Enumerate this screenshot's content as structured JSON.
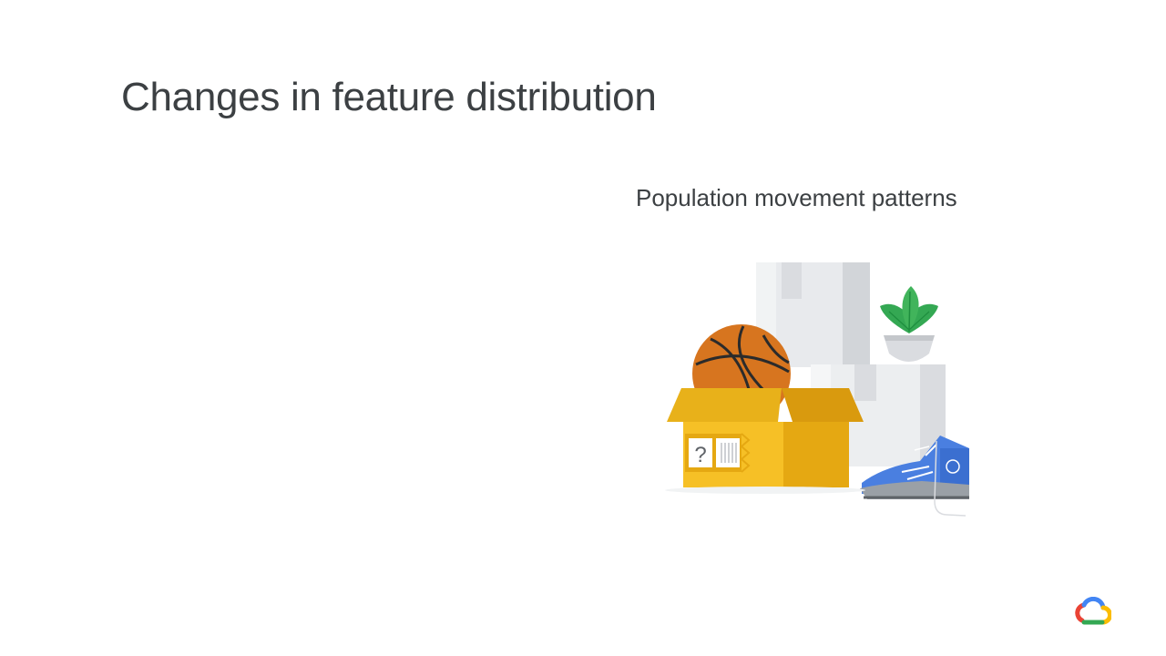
{
  "slide": {
    "title": "Changes in feature distribution",
    "subtitle": "Population movement patterns"
  },
  "illustration": {
    "label_mark": "?",
    "colors": {
      "box_light": "#f6c026",
      "box_dark": "#e5a812",
      "ball": "#d7751f",
      "plant": "#34a853",
      "pot": "#dadce0",
      "shoe": "#4a7fe0",
      "cartons": "#e8eaed"
    },
    "icons": [
      "basketball-icon",
      "cardboard-box-icon",
      "plant-icon",
      "sneaker-icon"
    ]
  },
  "logo": {
    "name": "google-cloud-logo",
    "colors": [
      "#ea4335",
      "#4285f4",
      "#fbbc04",
      "#34a853"
    ]
  }
}
